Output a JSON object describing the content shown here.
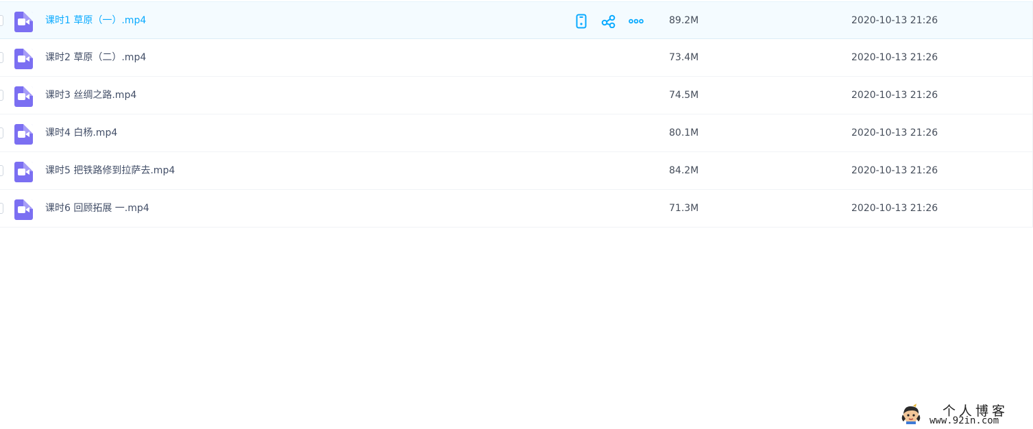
{
  "files": [
    {
      "name": "课时1 草原（一）.mp4",
      "size": "89.2M",
      "time": "2020-10-13 21:26",
      "hovered": true
    },
    {
      "name": "课时2 草原（二）.mp4",
      "size": "73.4M",
      "time": "2020-10-13 21:26",
      "hovered": false
    },
    {
      "name": "课时3 丝绸之路.mp4",
      "size": "74.5M",
      "time": "2020-10-13 21:26",
      "hovered": false
    },
    {
      "name": "课时4 白杨.mp4",
      "size": "80.1M",
      "time": "2020-10-13 21:26",
      "hovered": false
    },
    {
      "name": "课时5 把铁路修到拉萨去.mp4",
      "size": "84.2M",
      "time": "2020-10-13 21:26",
      "hovered": false
    },
    {
      "name": "课时6 回顾拓展 一.mp4",
      "size": "71.3M",
      "time": "2020-10-13 21:26",
      "hovered": false
    }
  ],
  "row_actions": [
    {
      "icon": "phone-icon"
    },
    {
      "icon": "share-icon"
    },
    {
      "icon": "more-icon"
    }
  ],
  "colors": {
    "accent": "#09aaff",
    "video_icon": "#7b6ff2",
    "text": "#424e67"
  },
  "watermark": {
    "title": "个人博客",
    "url": "www.92in.com"
  }
}
